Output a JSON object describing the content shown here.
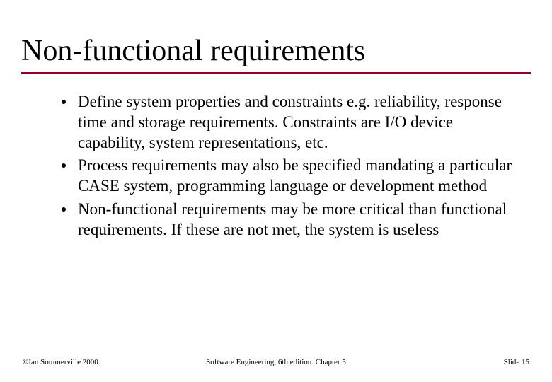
{
  "title": "Non-functional requirements",
  "bullets": [
    "Define system properties and constraints e.g. reliability, response time and storage requirements. Constraints are I/O device capability, system representations, etc.",
    "Process requirements may also be specified mandating a particular CASE system, programming language or development method",
    "Non-functional requirements may be more critical than functional requirements. If these are not met, the system is useless"
  ],
  "footer": {
    "left": "©Ian Sommerville 2000",
    "center": "Software Engineering, 6th edition. Chapter 5",
    "right": "Slide 15"
  }
}
